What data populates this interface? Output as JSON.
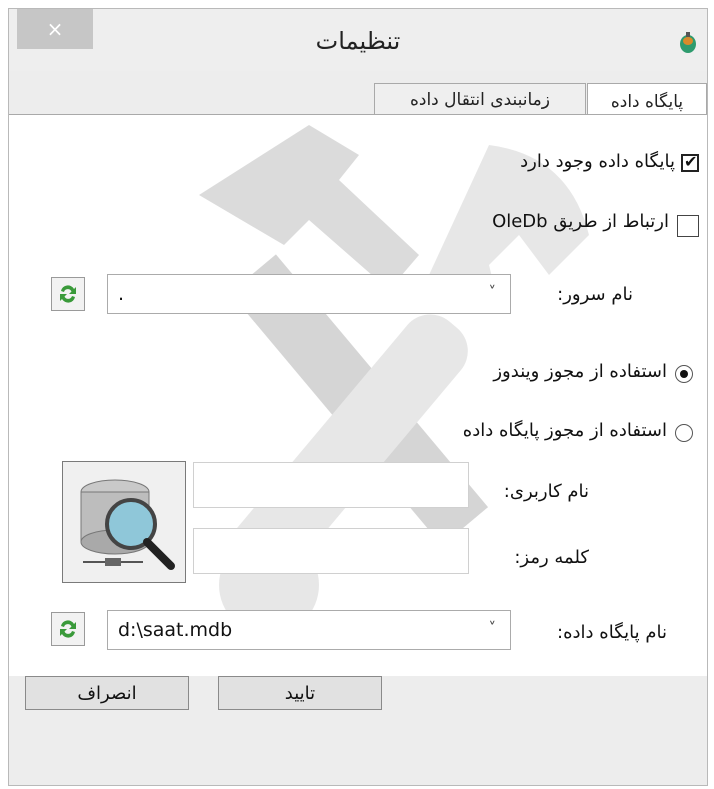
{
  "window": {
    "title": "تنظیمات",
    "close_glyph": "×",
    "app_icon": "app-icon"
  },
  "tabs": [
    {
      "label": "پایگاه داده",
      "active": true
    },
    {
      "label": "زمانبندی انتقال داده",
      "active": false
    }
  ],
  "database_tab": {
    "db_exists_label": "پایگاه داده وجود دارد",
    "db_exists_checked": true,
    "oledb_label": "ارتباط از طریق OleDb",
    "oledb_checked": false,
    "server_label": "نام سرور:",
    "server_value": ".",
    "auth_windows_label": "استفاده از مجوز ویندوز",
    "auth_windows_selected": true,
    "auth_db_label": "استفاده از مجوز پایگاه داده",
    "auth_db_selected": false,
    "username_label": "نام کاربری:",
    "username_value": "",
    "password_label": "کلمه رمز:",
    "password_value": "",
    "dbname_label": "نام پایگاه داده:",
    "dbname_value": "d:\\saat.mdb"
  },
  "footer": {
    "ok_label": "تایید",
    "cancel_label": "انصراف"
  },
  "colors": {
    "panel": "#ffffff",
    "window": "#ededed",
    "refresh_green": "#3a9a3a"
  }
}
